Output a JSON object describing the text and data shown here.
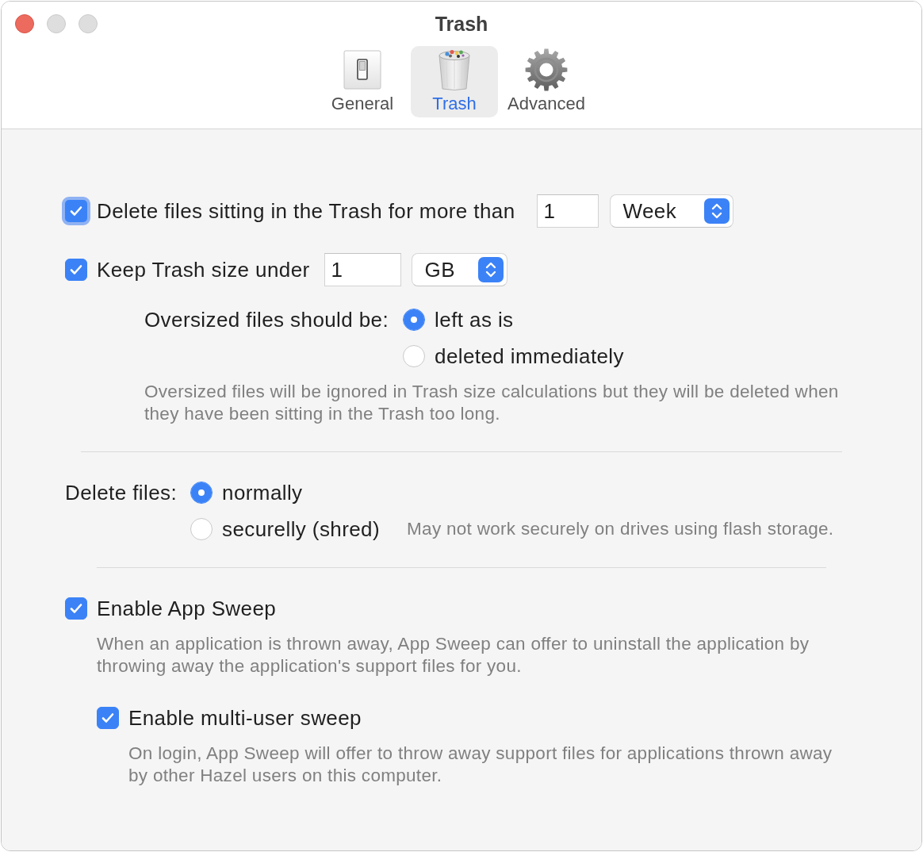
{
  "window": {
    "title": "Trash"
  },
  "toolbar": [
    {
      "label": "General",
      "kind": "switch",
      "selected": false
    },
    {
      "label": "Trash",
      "kind": "trash",
      "selected": true
    },
    {
      "label": "Advanced",
      "kind": "gear",
      "selected": false
    }
  ],
  "age_limit": {
    "label": "Delete files sitting in the Trash for more than",
    "checked": true,
    "focused": true,
    "amount": "1",
    "unit": "Week"
  },
  "size_limit": {
    "label": "Keep Trash size under",
    "checked": true,
    "amount": "1",
    "unit": "GB"
  },
  "oversized": {
    "label": "Oversized files should be:",
    "options": [
      {
        "label": "left as is",
        "selected": true
      },
      {
        "label": "deleted immediately",
        "selected": false
      }
    ],
    "note": "Oversized files will be ignored in Trash size calculations but they will be deleted when they have been sitting in the Trash too long."
  },
  "delete_mode": {
    "label": "Delete files:",
    "options": [
      {
        "label": "normally",
        "selected": true
      },
      {
        "label": "securelly (shred)",
        "selected": false,
        "note": "May not work securely on drives using flash storage."
      }
    ]
  },
  "app_sweep": {
    "label": "Enable App Sweep",
    "checked": true,
    "note": "When an application is thrown away, App Sweep can offer to uninstall the application by throwing away the application's support files for you."
  },
  "multi_user_sweep": {
    "label": "Enable multi-user sweep",
    "checked": true,
    "note": "On login, App Sweep will offer to throw away support files for applications thrown away by other Hazel users on this computer."
  }
}
